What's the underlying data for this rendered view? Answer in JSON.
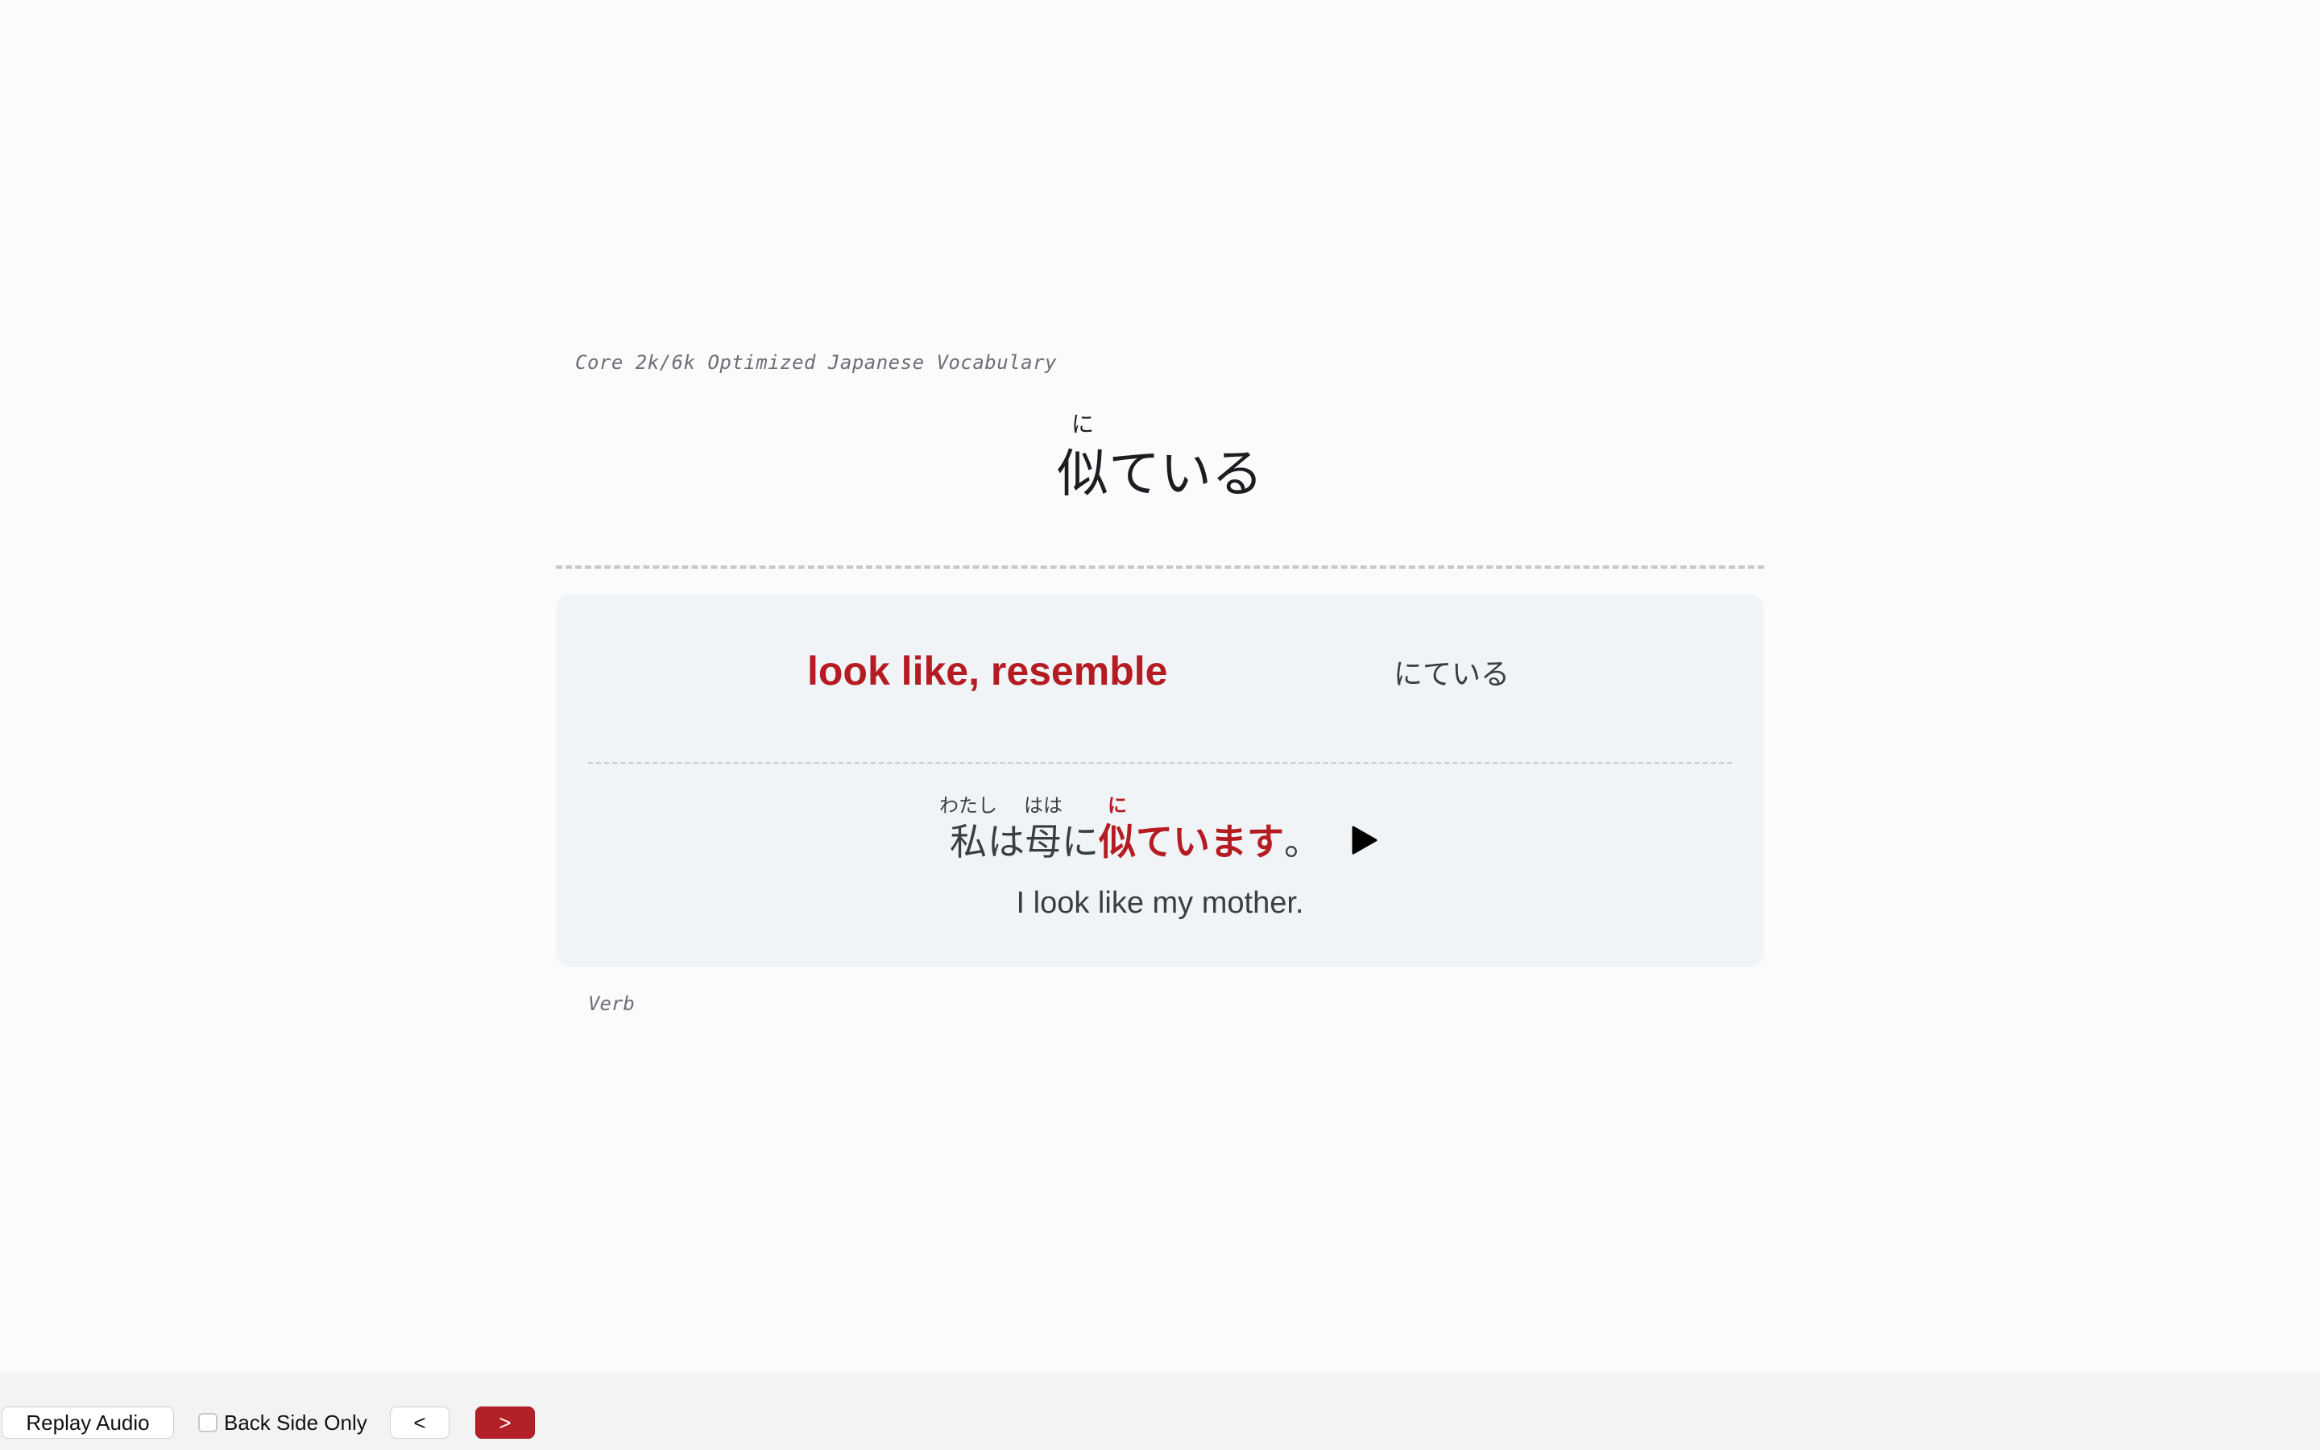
{
  "card": {
    "deck_name": "Core 2k/6k Optimized Japanese Vocabulary",
    "headword": {
      "kanji": "似",
      "furigana": "に",
      "okurigana": "ている"
    },
    "meaning": "look like, resemble",
    "reading": "にている",
    "sentence": {
      "w1": "私",
      "w1_furigana": "わたし",
      "w2": "は",
      "w3": "母",
      "w3_furigana": "はは",
      "w4": "に",
      "target_kanji": "似",
      "target_furigana": "に",
      "target_rest": "ています",
      "end_punct": "。"
    },
    "play_icon": "play-icon",
    "translation": "I look like my mother.",
    "part_of_speech": "Verb"
  },
  "toolbar": {
    "replay_label": "Replay Audio",
    "back_side_label": "Back Side Only",
    "back_side_checked": false,
    "prev_label": "<",
    "next_label": ">"
  },
  "colors": {
    "accent": "#b51c22",
    "card_bg": "#f0f4f7",
    "page_bg": "#fbfbfc"
  }
}
